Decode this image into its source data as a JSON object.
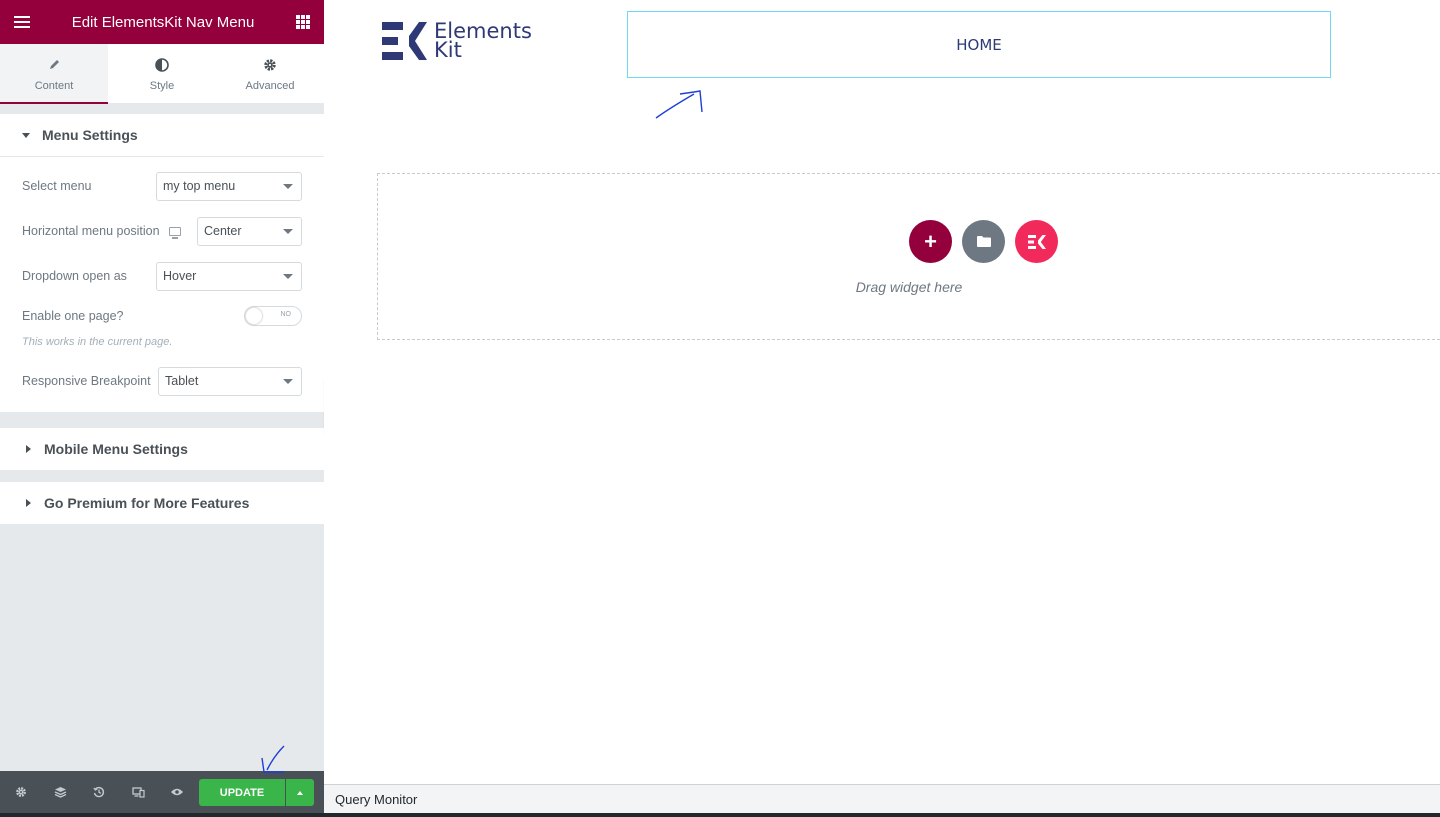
{
  "panel": {
    "title": "Edit ElementsKit Nav Menu",
    "tabs": [
      {
        "label": "Content",
        "icon": "pencil-icon"
      },
      {
        "label": "Style",
        "icon": "half-circle-icon"
      },
      {
        "label": "Advanced",
        "icon": "gear-icon"
      }
    ],
    "menu_settings": {
      "title": "Menu Settings",
      "select_menu": {
        "label": "Select menu",
        "value": "my top menu"
      },
      "horizontal_position": {
        "label": "Horizontal menu position",
        "value": "Center"
      },
      "dropdown_open": {
        "label": "Dropdown open as",
        "value": "Hover"
      },
      "one_page": {
        "label": "Enable one page?",
        "toggle_text": "NO",
        "description": "This works in the current page."
      },
      "breakpoint": {
        "label": "Responsive Breakpoint",
        "value": "Tablet"
      }
    },
    "mobile_settings_title": "Mobile Menu Settings",
    "premium_title": "Go Premium for More Features",
    "footer": {
      "update_label": "UPDATE",
      "icons": [
        "gear-icon",
        "layers-icon",
        "history-icon",
        "responsive-icon",
        "eye-icon"
      ]
    }
  },
  "canvas": {
    "logo": {
      "line1": "Elements",
      "line2": "Kit"
    },
    "nav_item": "HOME",
    "drop_text": "Drag widget here",
    "add_symbol": "+"
  },
  "query_monitor": "Query Monitor",
  "colors": {
    "brand": "#93003c",
    "update_green": "#39b54a",
    "ek_pink": "#f2295b",
    "logo_navy": "#2f3976",
    "nav_border": "#71d7f7"
  }
}
